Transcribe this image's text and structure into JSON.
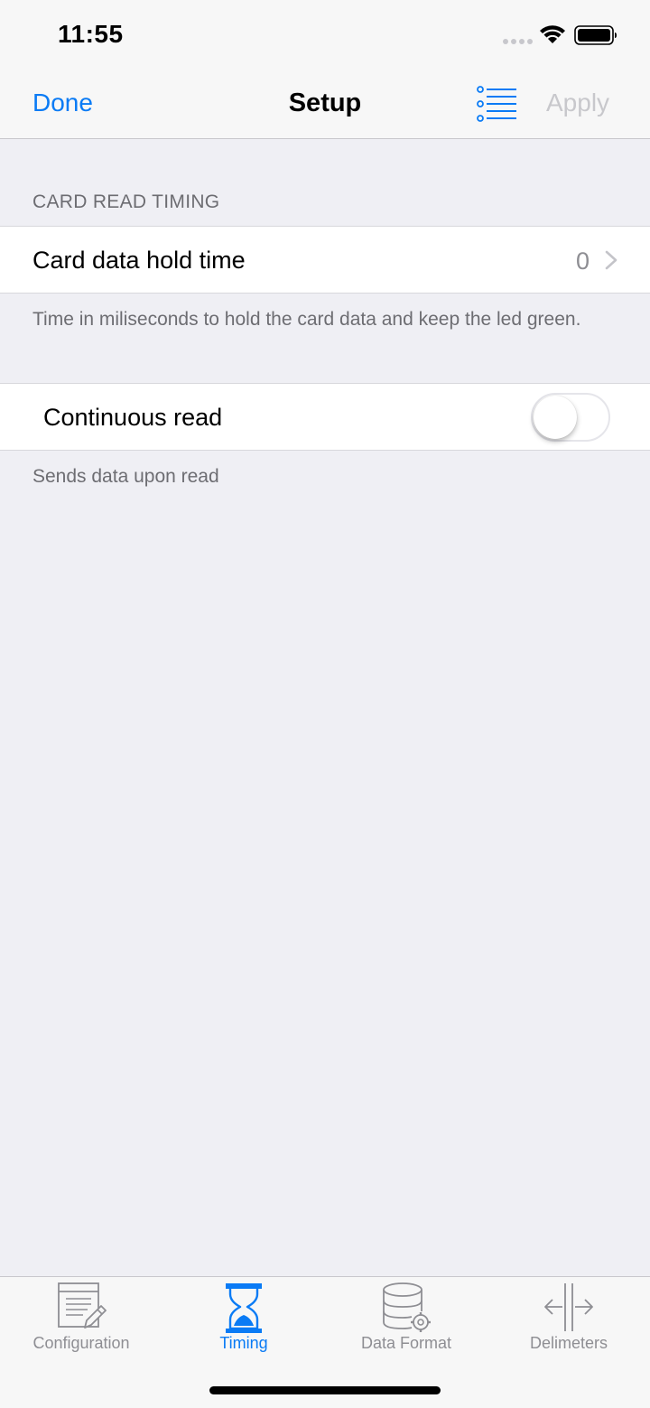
{
  "status_bar": {
    "time": "11:55",
    "signal_icon": "cellular-signal-icon",
    "wifi_icon": "wifi-icon",
    "battery_icon": "battery-icon"
  },
  "nav": {
    "done_label": "Done",
    "title": "Setup",
    "list_icon": "list-icon",
    "apply_label": "Apply",
    "accent_color": "#0a7bf5",
    "disabled_color": "#c8c8cc"
  },
  "section": {
    "header": "CARD READ TIMING"
  },
  "hold_time": {
    "label": "Card data hold time",
    "value": "0",
    "footer": "Time in miliseconds to hold the card data and keep the led green."
  },
  "continuous_read": {
    "label": "Continuous read",
    "enabled": false,
    "footer": "Sends data upon read"
  },
  "tab_bar": {
    "active": "Timing",
    "tabs": [
      {
        "label": "Configuration",
        "icon": "configuration-document-icon"
      },
      {
        "label": "Timing",
        "icon": "hourglass-icon"
      },
      {
        "label": "Data Format",
        "icon": "database-gear-icon"
      },
      {
        "label": "Delimeters",
        "icon": "delimiter-arrows-icon"
      }
    ]
  }
}
